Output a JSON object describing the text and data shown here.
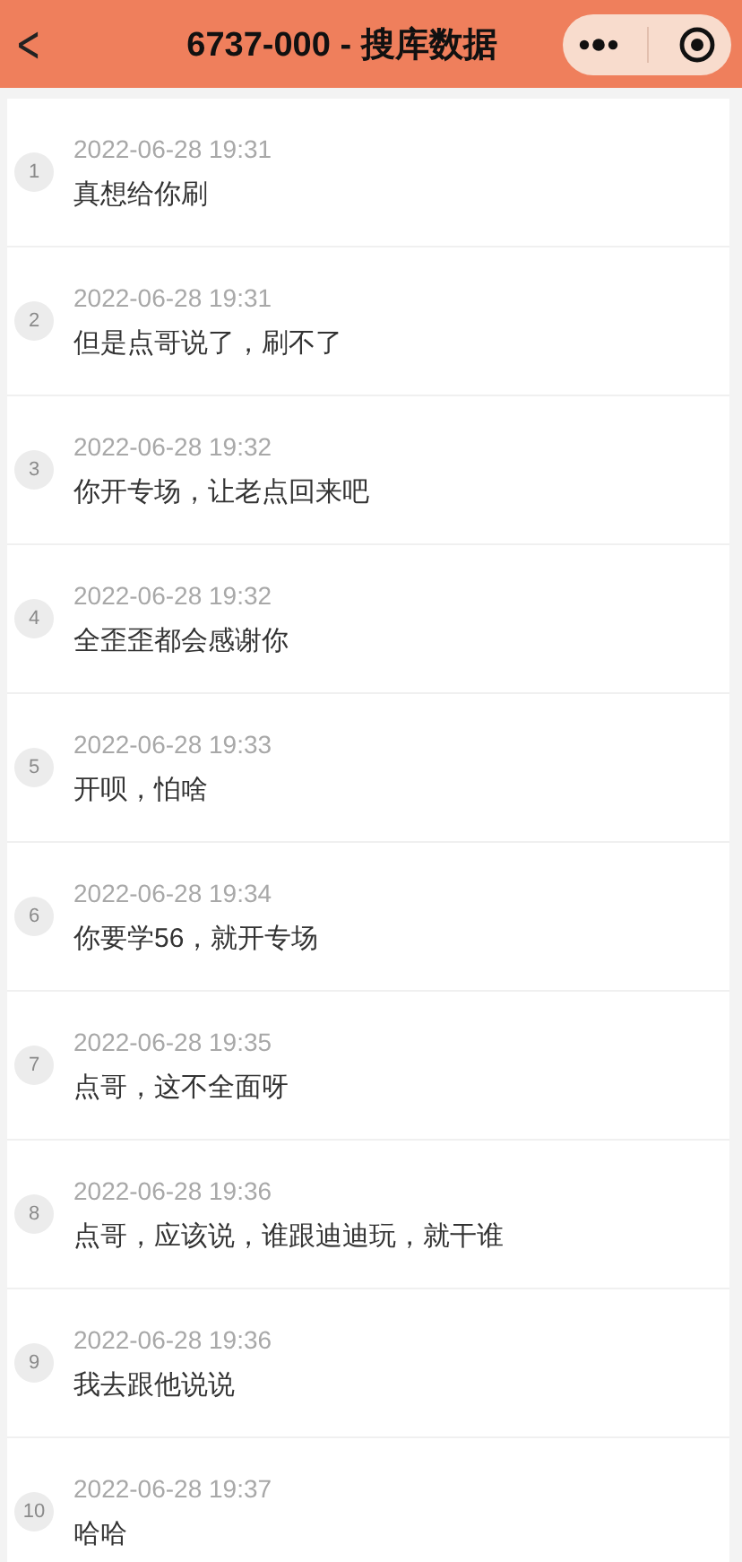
{
  "nav": {
    "back": "<",
    "title": "6737-000 - 搜库数据"
  },
  "messages": [
    {
      "index": "1",
      "time": "2022-06-28 19:31",
      "text": "真想给你刷"
    },
    {
      "index": "2",
      "time": "2022-06-28 19:31",
      "text": "但是点哥说了，刷不了"
    },
    {
      "index": "3",
      "time": "2022-06-28 19:32",
      "text": "你开专场，让老点回来吧"
    },
    {
      "index": "4",
      "time": "2022-06-28 19:32",
      "text": "全歪歪都会感谢你"
    },
    {
      "index": "5",
      "time": "2022-06-28 19:33",
      "text": "开呗，怕啥"
    },
    {
      "index": "6",
      "time": "2022-06-28 19:34",
      "text": "你要学56，就开专场"
    },
    {
      "index": "7",
      "time": "2022-06-28 19:35",
      "text": "点哥，这不全面呀"
    },
    {
      "index": "8",
      "time": "2022-06-28 19:36",
      "text": "点哥，应该说，谁跟迪迪玩，就干谁"
    },
    {
      "index": "9",
      "time": "2022-06-28 19:36",
      "text": "我去跟他说说"
    },
    {
      "index": "10",
      "time": "2022-06-28 19:37",
      "text": "哈哈"
    }
  ]
}
